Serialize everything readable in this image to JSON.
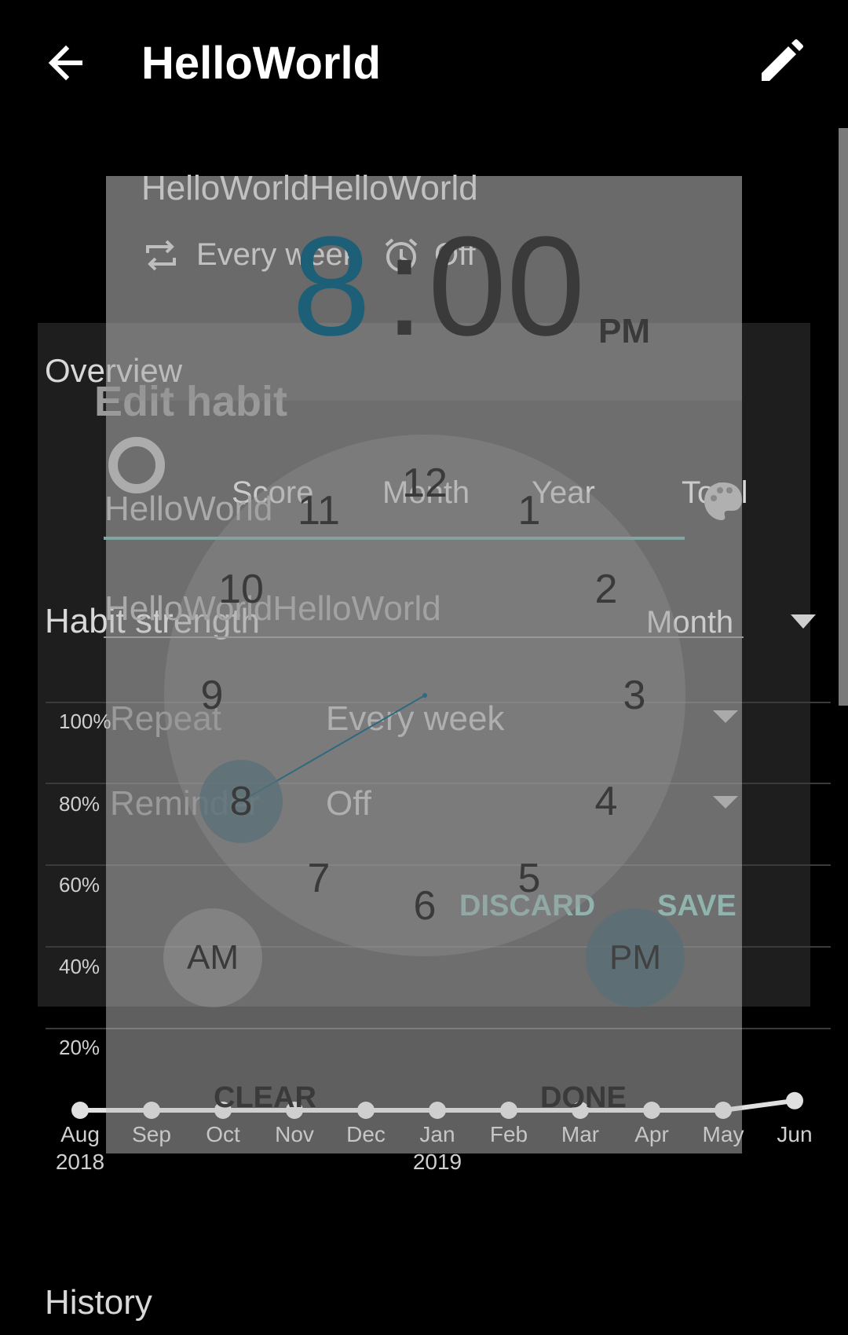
{
  "app_bar": {
    "title": "HelloWorld",
    "back_icon": "arrow-back-icon",
    "edit_icon": "pencil-icon"
  },
  "habit": {
    "name": "HelloWorldHelloWorld",
    "repeat_text": "Every week",
    "reminder_text": "Off"
  },
  "overview": {
    "label": "Overview",
    "stats": [
      "Score",
      "Month",
      "Year",
      "Total"
    ]
  },
  "habit_strength": {
    "label": "Habit strength",
    "period": "Month"
  },
  "chart_data": {
    "type": "line",
    "x": [
      "Aug 2018",
      "Sep",
      "Oct",
      "Nov",
      "Dec",
      "Jan 2019",
      "Feb",
      "Mar",
      "Apr",
      "May",
      "Jun"
    ],
    "x_labels_line1": [
      "Aug",
      "Sep",
      "Oct",
      "Nov",
      "Dec",
      "Jan",
      "Feb",
      "Mar",
      "Apr",
      "May",
      "Jun"
    ],
    "x_labels_line2": [
      "2018",
      "",
      "",
      "",
      "",
      "2019",
      "",
      "",
      "",
      "",
      ""
    ],
    "values": [
      0,
      0,
      0,
      0,
      0,
      0,
      0,
      0,
      0,
      0,
      1
    ],
    "yticks": [
      "100%",
      "80%",
      "60%",
      "40%",
      "20%"
    ],
    "ylim": [
      0,
      100
    ],
    "grid": true,
    "line_color": "#e0e0e0"
  },
  "history": {
    "label": "History"
  },
  "edit_dialog": {
    "title": "Edit habit",
    "name_value": "HelloWorld",
    "description_value": "HelloWorldHelloWorld",
    "repeat_label": "Repeat",
    "repeat_value": "Every week",
    "reminder_label": "Reminder",
    "reminder_value": "Off",
    "discard_label": "DISCARD",
    "save_label": "SAVE",
    "accent_color": "#8fb3ad"
  },
  "time_picker": {
    "hour": "8",
    "colon": ":",
    "minutes": "00",
    "ampm": "PM",
    "clock_numbers": [
      "12",
      "1",
      "2",
      "3",
      "4",
      "5",
      "6",
      "7",
      "8",
      "9",
      "10",
      "11"
    ],
    "selected_hour": "8",
    "am_label": "AM",
    "pm_label": "PM",
    "clear_label": "CLEAR",
    "done_label": "DONE",
    "accent_color": "#1e5f78"
  },
  "colors": {
    "background": "#000000",
    "card": "#1e1e1e",
    "text": "#d8d8d8"
  }
}
